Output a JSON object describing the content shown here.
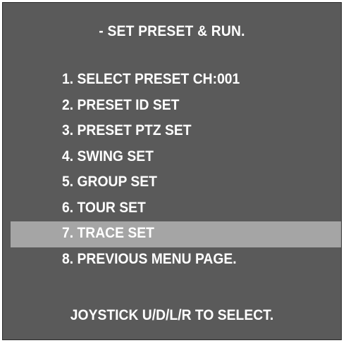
{
  "title": "- SET PRESET & RUN.",
  "menu": {
    "items": [
      {
        "label": "1. SELECT PRESET CH:001"
      },
      {
        "label": "2. PRESET ID SET"
      },
      {
        "label": "3. PRESET PTZ SET"
      },
      {
        "label": "4. SWING SET"
      },
      {
        "label": "5. GROUP SET"
      },
      {
        "label": "6. TOUR SET"
      },
      {
        "label": "7. TRACE SET",
        "selected": true
      },
      {
        "label": "8. PREVIOUS MENU PAGE."
      }
    ]
  },
  "footer": "JOYSTICK U/D/L/R TO SELECT.",
  "colors": {
    "background": "#5a5a5a",
    "highlight": "#a5a5a5",
    "text": "#ffffff"
  }
}
